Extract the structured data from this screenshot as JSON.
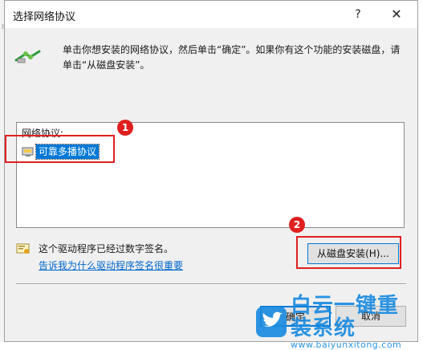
{
  "dialog": {
    "title": "选择网络协议",
    "help_glyph": "?",
    "close_glyph": "✕",
    "description": "单击你想安装的网络协议，然后单击“确定”。如果你有这个功能的安装磁盘，请单击“从磁盘安装”。"
  },
  "protocol_list": {
    "header": "网络协议:",
    "items": [
      {
        "label": "可靠多播协议",
        "selected": true
      }
    ]
  },
  "driver_info": {
    "signed_text": "这个驱动程序已经过数字签名。",
    "why_link": "告诉我为什么驱动程序签名很重要"
  },
  "buttons": {
    "have_disk": "从磁盘安装(H)...",
    "ok": "确定",
    "cancel": "取消"
  },
  "annotations": {
    "badge_1": "1",
    "badge_2": "2",
    "highlight_color": "#e02020"
  },
  "watermark": {
    "brand": "白云一键重装系统",
    "url": "www.baiyunxitong.com",
    "color": "#1a8be0"
  },
  "colors": {
    "selection": "#0078d7",
    "link": "#0066cc",
    "dialog_bg": "#f0f0f0"
  }
}
